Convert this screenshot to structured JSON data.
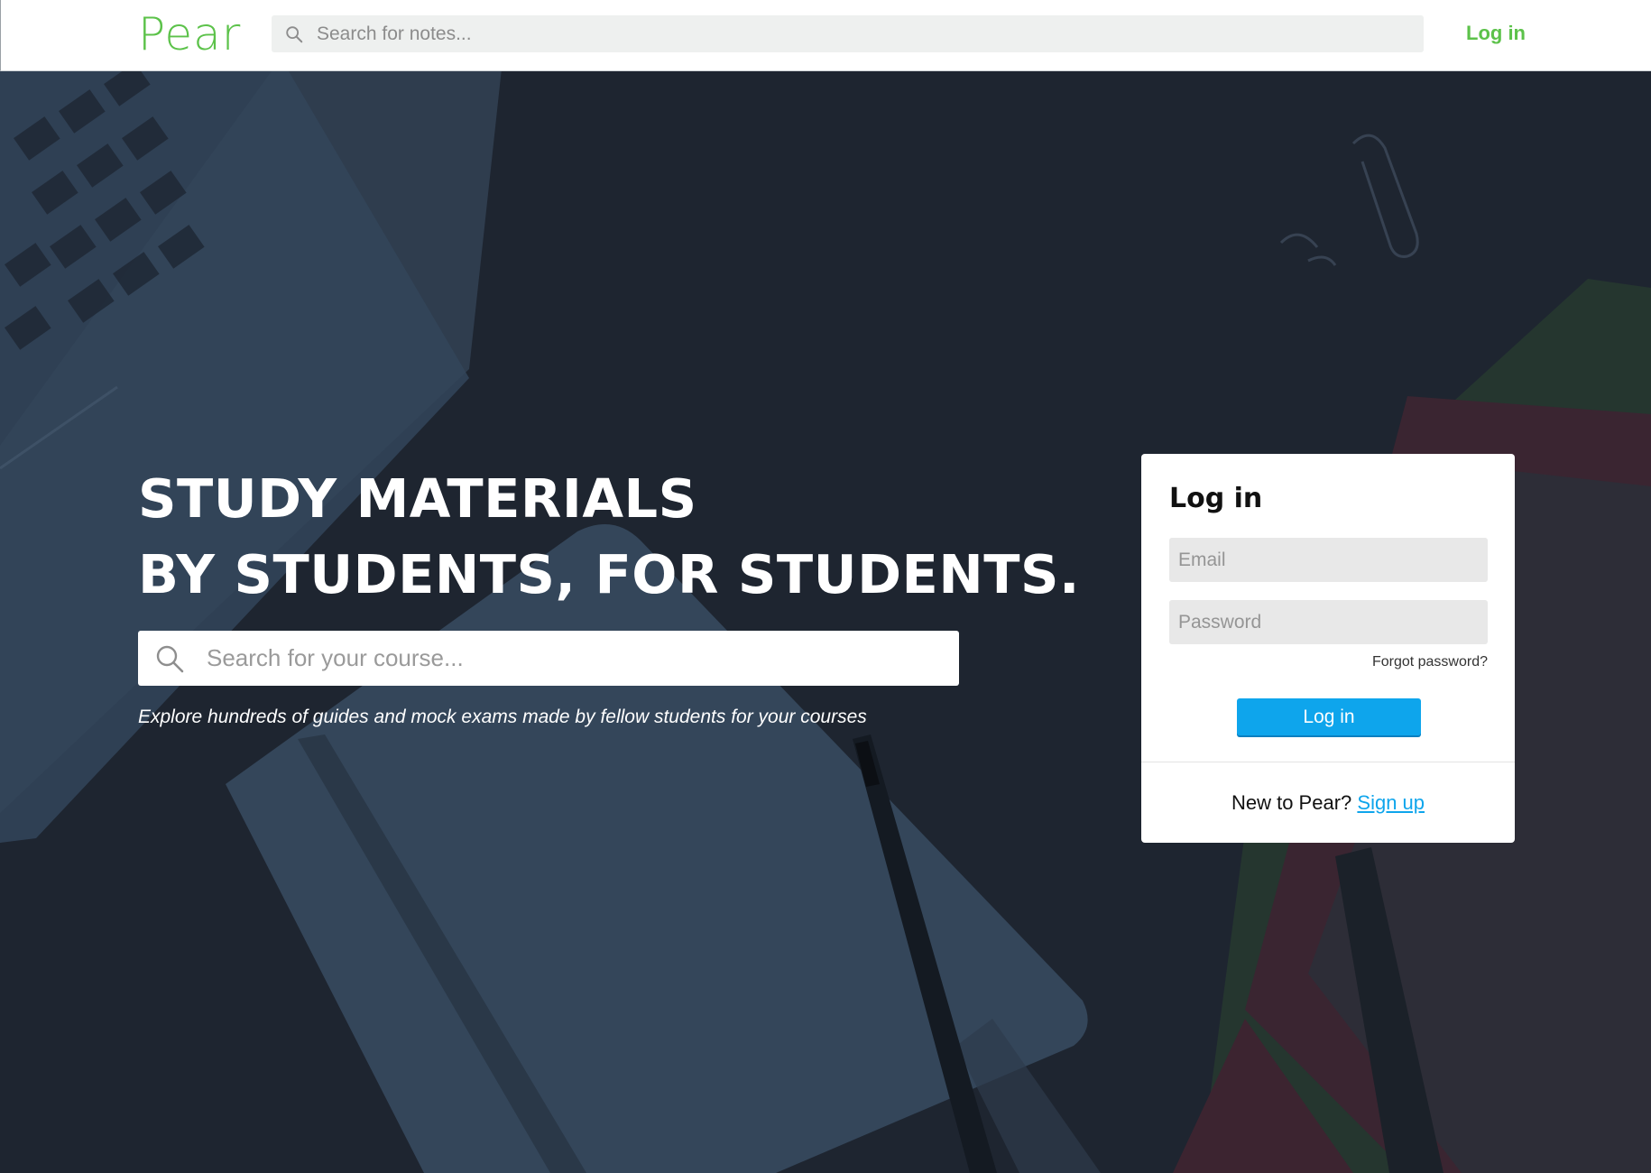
{
  "brand": {
    "name": "Pear",
    "color": "#5cc24a",
    "link_color": "#5cc24a"
  },
  "header": {
    "search_placeholder": "Search for notes...",
    "login_label": "Log in"
  },
  "hero": {
    "headline_line1": "STUDY MATERIALS",
    "headline_line2": "BY STUDENTS, FOR STUDENTS.",
    "course_search_placeholder": "Search for your course...",
    "tagline": "Explore hundreds of guides and mock exams made by fellow students for your courses"
  },
  "login_card": {
    "title": "Log in",
    "email_placeholder": "Email",
    "password_placeholder": "Password",
    "forgot_label": "Forgot password?",
    "submit_label": "Log in",
    "submit_color": "#0ea5ec",
    "signup_prompt": "New to Pear?",
    "signup_link": "Sign up",
    "signup_link_color": "#0ea5ec"
  },
  "icons": {
    "top_search": "search-icon",
    "course_search": "search-icon"
  }
}
